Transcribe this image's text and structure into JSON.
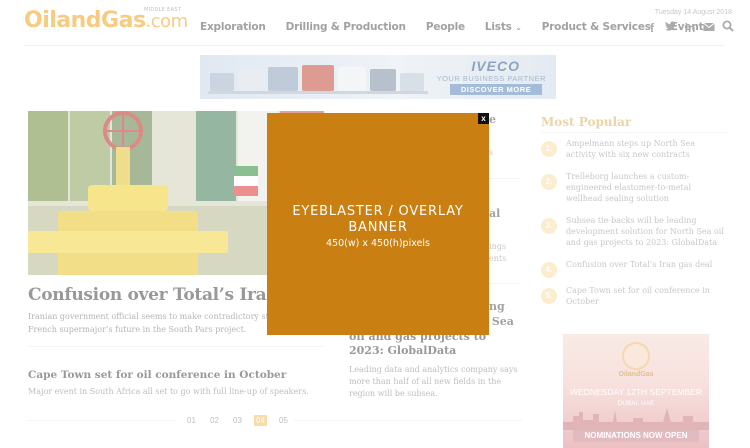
{
  "logo": {
    "text": "OilandGas",
    "suffix": ".com",
    "sub": "MIDDLE EAST"
  },
  "date": "Tuesday 14 August 2018",
  "nav": {
    "items": [
      {
        "label": "Exploration"
      },
      {
        "label": "Drilling & Production"
      },
      {
        "label": "People"
      },
      {
        "label": "Lists"
      },
      {
        "label": "Product & Services"
      },
      {
        "label": "Events"
      }
    ]
  },
  "social": [
    "facebook-icon",
    "twitter-icon",
    "linkedin-icon",
    "mail-icon",
    "search-icon"
  ],
  "ad": {
    "brand": "IVECO",
    "tagline": "YOUR BUSINESS PARTNER",
    "cta": "DISCOVER MORE"
  },
  "main": {
    "headline": "Confusion over Total’s Iran gas deal",
    "summary": "Iranian government official seems to make contradictory statements over French supermajor’s future in the South Pars project.",
    "story2": {
      "title": "Cape Town set for oil conference in October",
      "summary": "Major event in South Africa all set to go with full line-up of speakers."
    }
  },
  "middle": {
    "frag1": "e",
    "frag2": "s",
    "frag3": "al",
    "frag4": "ings",
    "frag5": "ents",
    "frag6": "ng",
    "frag7": "h Sea",
    "story_title": "oil and gas projects to 2023: GlobalData",
    "story_summary": "Leading data and analytics company says more than half of all new fields in the region will be subsea."
  },
  "pagination": {
    "pages": [
      "01",
      "02",
      "03",
      "04",
      "05"
    ],
    "active_index": 3
  },
  "most_popular": {
    "title": "Most Popular",
    "items": [
      {
        "num": "1.",
        "text": "Ampelmann steps up North Sea activity with six new contracts"
      },
      {
        "num": "2.",
        "text": "Trelleborg launches a custom-engineered elastomer-to-metal wellhead sealing solution"
      },
      {
        "num": "3.",
        "text": "Subsea tie-backs will be leading development solution for North Sea oil and gas projects to 2023: GlobalData"
      },
      {
        "num": "4.",
        "text": "Confusion over Total’s Iran gas deal"
      },
      {
        "num": "5.",
        "text": "Cape Town set for oil conference in October"
      }
    ]
  },
  "side_ad": {
    "brand": "OilandGas",
    "date_line1": "WEDNESDAY 12TH SEPTEMBER",
    "date_line2": "DUBAI, UAE",
    "cta": "NOMINATIONS NOW OPEN"
  },
  "overlay": {
    "close": "x",
    "title_line1": "EYEBLASTER / OVERLAY",
    "title_line2": "BANNER",
    "size": "450(w) x 450(h)pixels"
  }
}
